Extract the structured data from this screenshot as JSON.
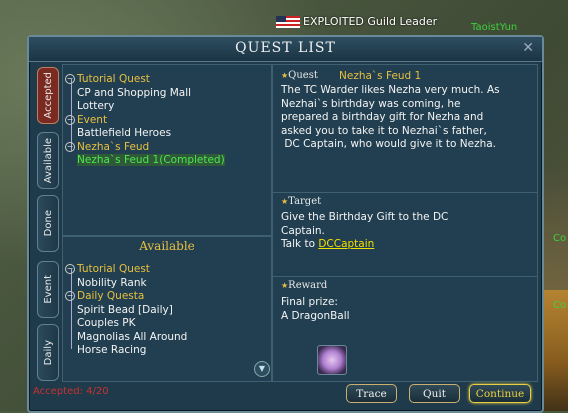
{
  "header": {
    "player_label": "EXPLOITED Guild Leader"
  },
  "npcs": {
    "taoist": "TaoistYun",
    "side1": "Co",
    "side2": "Co"
  },
  "window": {
    "title": "QUEST LIST",
    "close_glyph": "✕",
    "tabs": [
      "Accepted",
      "Available",
      "Done",
      "Event",
      "Daily"
    ],
    "active_tab": "Accepted"
  },
  "accepted_tree": [
    {
      "type": "cat",
      "label": "Tutorial Quest"
    },
    {
      "type": "item",
      "label": "CP and Shopping Mall"
    },
    {
      "type": "item",
      "label": "Lottery"
    },
    {
      "type": "cat",
      "label": "Event"
    },
    {
      "type": "item",
      "label": "Battlefield Heroes"
    },
    {
      "type": "cat",
      "label": "Nezha`s Feud"
    },
    {
      "type": "done",
      "label": "Nezha`s Feud 1(Completed)"
    }
  ],
  "available_title": "Available",
  "available_tree": [
    {
      "type": "cat",
      "label": "Tutorial Quest"
    },
    {
      "type": "item",
      "label": "Nobility Rank"
    },
    {
      "type": "cat",
      "label": "Daily Questa"
    },
    {
      "type": "item",
      "label": "Spirit Bead [Daily]"
    },
    {
      "type": "item",
      "label": "Couples PK"
    },
    {
      "type": "item",
      "label": "Magnolias All Around"
    },
    {
      "type": "item",
      "label": "Horse Racing"
    }
  ],
  "quest": {
    "label": "Quest",
    "name": "Nezha`s Feud 1",
    "lines": [
      "The TC Warder likes Nezha very much. As",
      "Nezhai`s birthday was coming, he",
      "prepared a birthday gift for Nezha and",
      "asked you to take it to Nezhai`s father,",
      " DC Captain, who would give it to Nezha."
    ]
  },
  "target": {
    "label": "Target",
    "line1": "Give the Birthday Gift to the DC",
    "line2": "Captain.",
    "line3_prefix": "Talk to ",
    "link": "DCCaptain"
  },
  "reward": {
    "label": "Reward",
    "line1": "Final prize:",
    "line2": "A DragonBall"
  },
  "footer": {
    "accepted_count": "Accepted: 4/20",
    "trace": "Trace",
    "quit": "Quit",
    "continue": "Continue"
  }
}
